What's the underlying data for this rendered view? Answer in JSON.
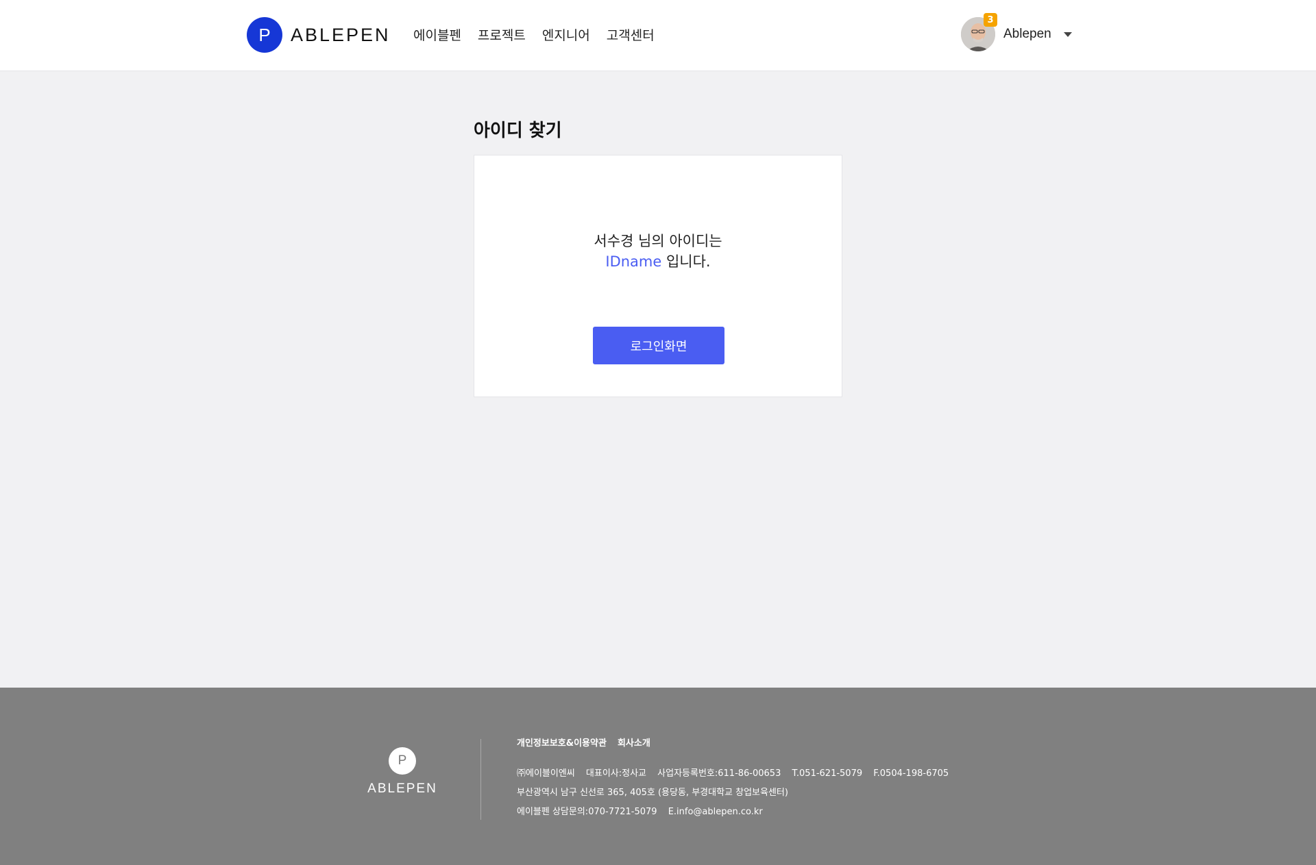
{
  "header": {
    "logo_letter": "P",
    "logo_text": "ABLEPEN",
    "nav": [
      "에이블펜",
      "프로젝트",
      "엔지니어",
      "고객센터"
    ],
    "user": {
      "notification_count": "3",
      "name": "Ablepen"
    }
  },
  "main": {
    "title": "아이디 찾기",
    "message_line1": "서수경 님의 아이디는",
    "id_value": "IDname",
    "message_suffix": " 입니다.",
    "login_button": "로그인화면"
  },
  "footer": {
    "logo_letter": "P",
    "logo_text": "ABLEPEN",
    "links": [
      "개인정보보호&이용약관",
      "회사소개"
    ],
    "company": "㈜에이블이엔씨",
    "ceo": "대표이사:정사교",
    "business_no": "사업자등록번호:611-86-00653",
    "tel": "T.051-621-5079",
    "fax": "F.0504-198-6705",
    "address": "부산광역시 남구 신선로 365, 405호 (용당동, 부경대학교 창업보육센터)",
    "consult": "에이블펜 상담문의:070-7721-5079",
    "email": "E.info@ablepen.co.kr"
  },
  "colors": {
    "brand": "#1637d6",
    "accent": "#4a5df2",
    "badge": "#f5a300",
    "footer_bg": "#808080"
  }
}
